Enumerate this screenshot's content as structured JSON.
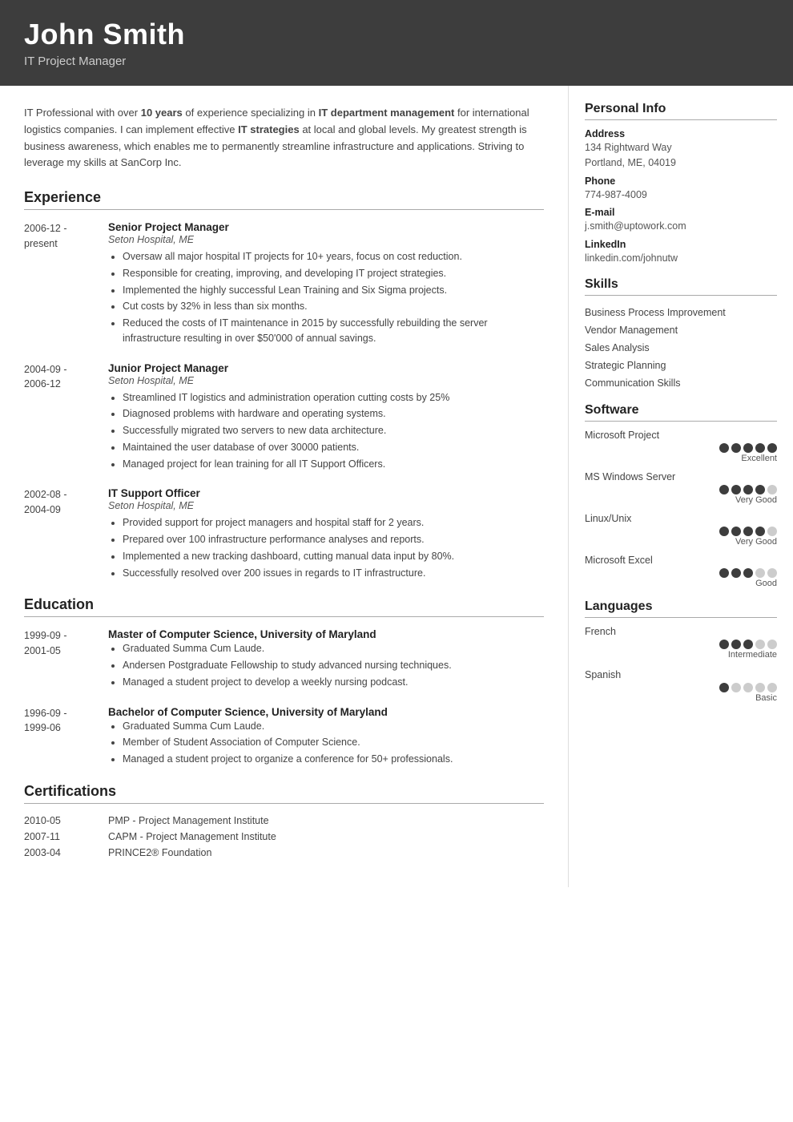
{
  "header": {
    "name": "John Smith",
    "title": "IT Project Manager"
  },
  "summary": {
    "text_parts": [
      {
        "text": "IT Professional with over ",
        "bold": false
      },
      {
        "text": "10 years",
        "bold": true
      },
      {
        "text": " of experience specializing in ",
        "bold": false
      },
      {
        "text": "IT department management",
        "bold": true
      },
      {
        "text": " for international logistics companies. I can implement effective ",
        "bold": false
      },
      {
        "text": "IT strategies",
        "bold": true
      },
      {
        "text": " at local and global levels. My greatest strength is business awareness, which enables me to permanently streamline infrastructure and applications. Striving to leverage my skills at SanCorp Inc.",
        "bold": false
      }
    ]
  },
  "sections": {
    "experience_title": "Experience",
    "education_title": "Education",
    "certifications_title": "Certifications"
  },
  "experience": [
    {
      "date_from": "2006-12 -",
      "date_to": "present",
      "title": "Senior Project Manager",
      "org": "Seton Hospital, ME",
      "bullets": [
        "Oversaw all major hospital IT projects for 10+ years, focus on cost reduction.",
        "Responsible for creating, improving, and developing IT project strategies.",
        "Implemented the highly successful Lean Training and Six Sigma projects.",
        "Cut costs by 32% in less than six months.",
        "Reduced the costs of IT maintenance in 2015 by successfully rebuilding the server infrastructure resulting in over $50'000 of annual savings."
      ]
    },
    {
      "date_from": "2004-09 -",
      "date_to": "2006-12",
      "title": "Junior Project Manager",
      "org": "Seton Hospital, ME",
      "bullets": [
        "Streamlined IT logistics and administration operation cutting costs by 25%",
        "Diagnosed problems with hardware and operating systems.",
        "Successfully migrated two servers to new data architecture.",
        "Maintained the user database of over 30000 patients.",
        "Managed project for lean training for all IT Support Officers."
      ]
    },
    {
      "date_from": "2002-08 -",
      "date_to": "2004-09",
      "title": "IT Support Officer",
      "org": "Seton Hospital, ME",
      "bullets": [
        "Provided support for project managers and hospital staff for 2 years.",
        "Prepared over 100 infrastructure performance analyses and reports.",
        "Implemented a new tracking dashboard, cutting manual data input by 80%.",
        "Successfully resolved over 200 issues in regards to IT infrastructure."
      ]
    }
  ],
  "education": [
    {
      "date_from": "1999-09 -",
      "date_to": "2001-05",
      "title": "Master of Computer Science, University of Maryland",
      "org": "",
      "bullets": [
        "Graduated Summa Cum Laude.",
        "Andersen Postgraduate Fellowship to study advanced nursing techniques.",
        "Managed a student project to develop a weekly nursing podcast."
      ]
    },
    {
      "date_from": "1996-09 -",
      "date_to": "1999-06",
      "title": "Bachelor of Computer Science, University of Maryland",
      "org": "",
      "bullets": [
        "Graduated Summa Cum Laude.",
        "Member of Student Association of Computer Science.",
        "Managed a student project to organize a conference for 50+ professionals."
      ]
    }
  ],
  "certifications": [
    {
      "date": "2010-05",
      "name": "PMP - Project Management Institute"
    },
    {
      "date": "2007-11",
      "name": "CAPM - Project Management Institute"
    },
    {
      "date": "2003-04",
      "name": "PRINCE2® Foundation"
    }
  ],
  "personal_info": {
    "title": "Personal Info",
    "address_label": "Address",
    "address_value": "134 Rightward Way\nPortland, ME, 04019",
    "phone_label": "Phone",
    "phone_value": "774-987-4009",
    "email_label": "E-mail",
    "email_value": "j.smith@uptowork.com",
    "linkedin_label": "LinkedIn",
    "linkedin_value": "linkedin.com/johnutw"
  },
  "skills": {
    "title": "Skills",
    "items": [
      "Business Process Improvement",
      "Vendor Management",
      "Sales Analysis",
      "Strategic Planning",
      "Communication Skills"
    ]
  },
  "software": {
    "title": "Software",
    "items": [
      {
        "name": "Microsoft Project",
        "filled": 5,
        "total": 5,
        "label": "Excellent"
      },
      {
        "name": "MS Windows Server",
        "filled": 4,
        "total": 5,
        "label": "Very Good"
      },
      {
        "name": "Linux/Unix",
        "filled": 4,
        "total": 5,
        "label": "Very Good"
      },
      {
        "name": "Microsoft Excel",
        "filled": 3,
        "total": 5,
        "label": "Good"
      }
    ]
  },
  "languages": {
    "title": "Languages",
    "items": [
      {
        "name": "French",
        "filled": 3,
        "total": 5,
        "label": "Intermediate"
      },
      {
        "name": "Spanish",
        "filled": 1,
        "total": 5,
        "label": "Basic"
      }
    ]
  }
}
